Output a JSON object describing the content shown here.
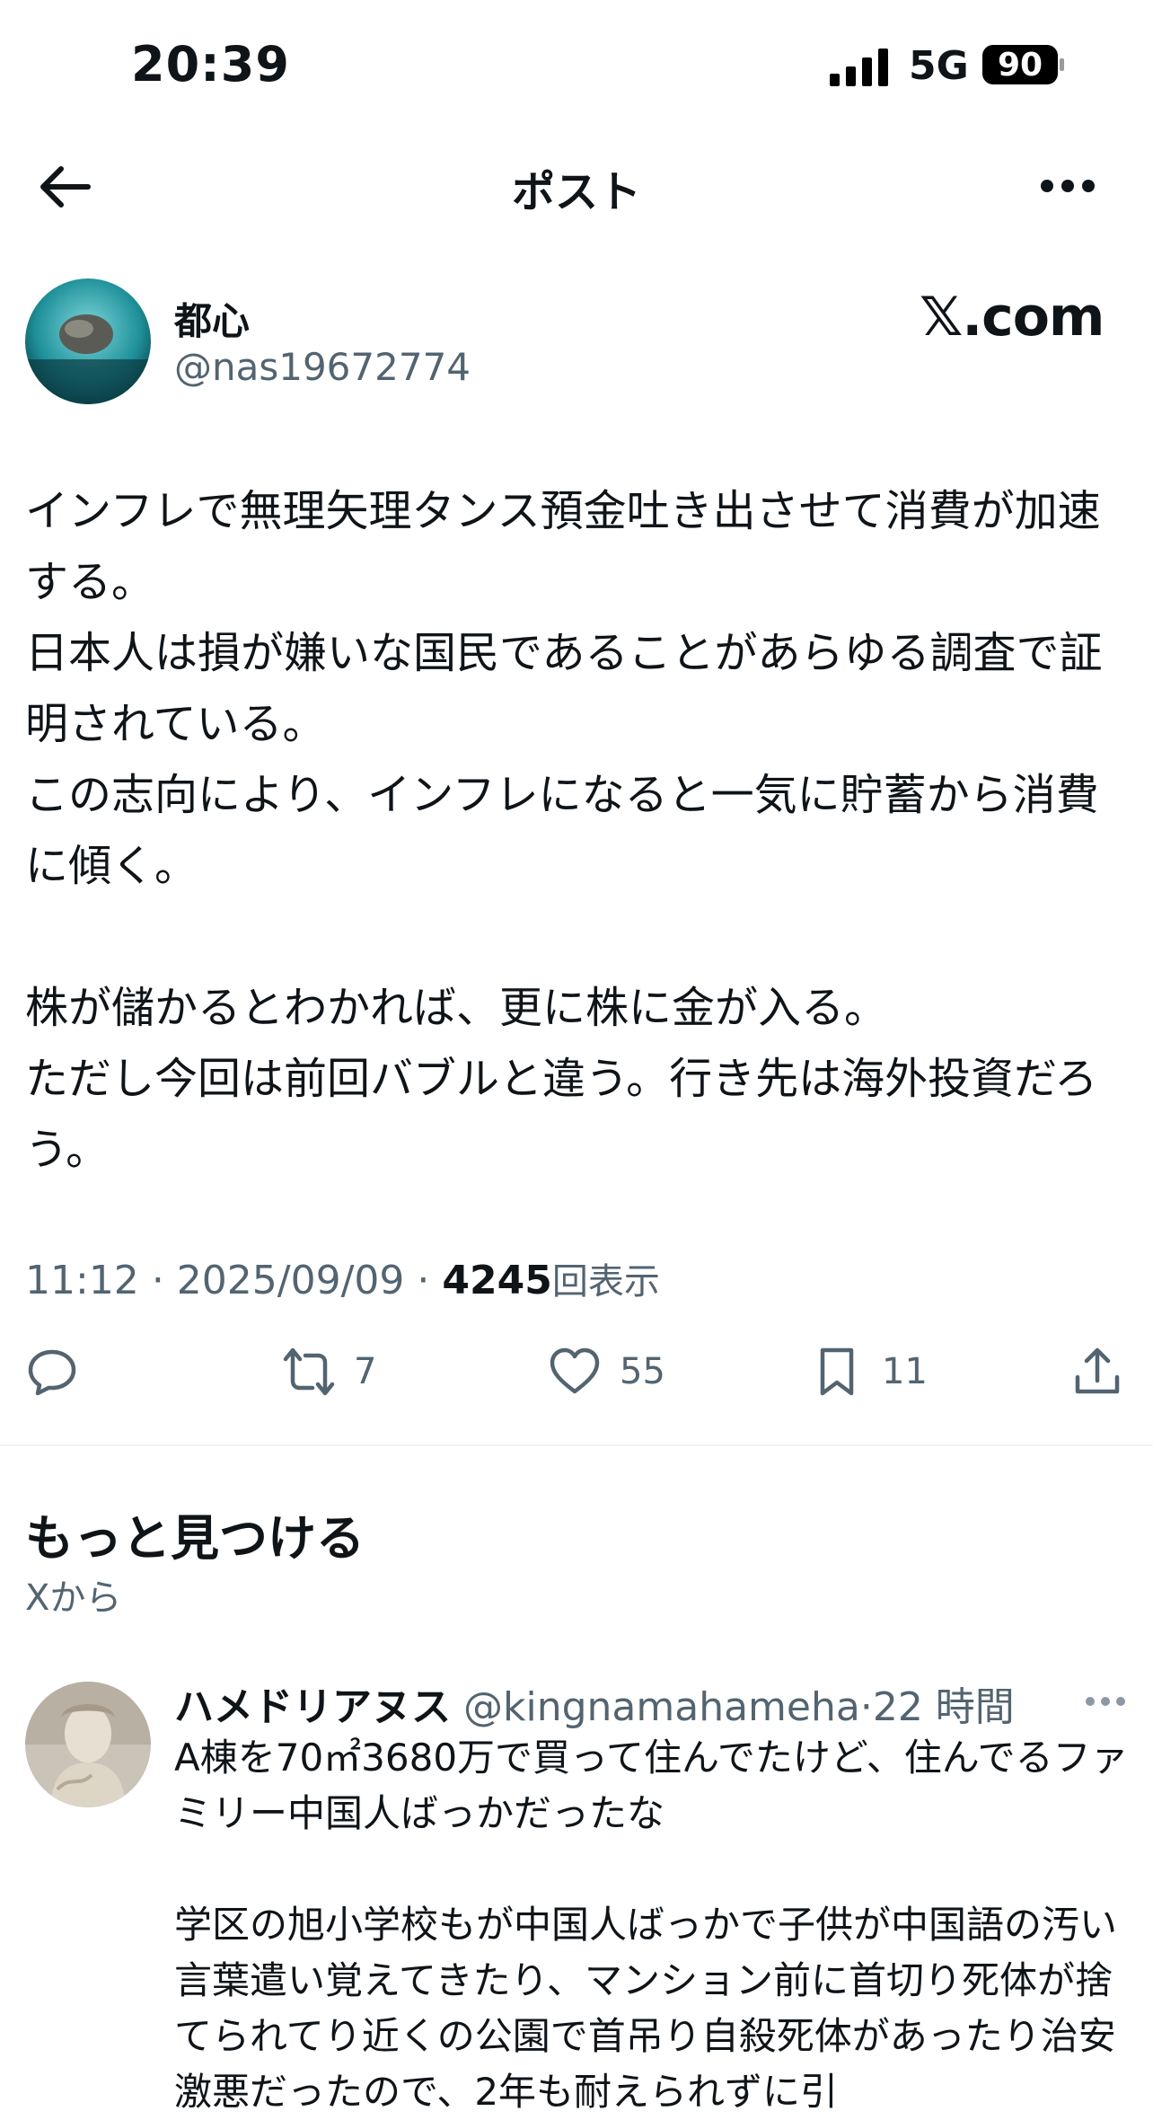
{
  "status_bar": {
    "time": "20:39",
    "network": "5G",
    "battery": "90"
  },
  "nav": {
    "title": "ポスト",
    "back_icon": "arrow-left-icon",
    "more_icon": "ellipsis-icon"
  },
  "author": {
    "name": "都心",
    "handle": "@nas19672774",
    "source_badge": "𝕏.com"
  },
  "post": {
    "text": "インフレで無理矢理タンス預金吐き出させて消費が加速する。\n日本人は損が嫌いな国民であることがあらゆる調査で証明されている。\nこの志向により、インフレになると一気に貯蓄から消費に傾く。\n\n株が儲かるとわかれば、更に株に金が入る。\nただし今回は前回バブルと違う。行き先は海外投資だろう。",
    "time": "11:12",
    "date": "2025/09/09",
    "views": "4245",
    "views_label": "回表示"
  },
  "actions": {
    "reply": {
      "icon": "reply-icon",
      "count": ""
    },
    "repost": {
      "icon": "repost-icon",
      "count": "7"
    },
    "like": {
      "icon": "heart-icon",
      "count": "55"
    },
    "bookmark": {
      "icon": "bookmark-icon",
      "count": "11"
    },
    "share": {
      "icon": "share-icon"
    }
  },
  "discover": {
    "title": "もっと見つける",
    "subtitle": "Xから"
  },
  "reply_post": {
    "name": "ハメドリアヌス",
    "handle": "@kingnamahameha",
    "separator": "·",
    "time": "22 時間",
    "text": "A棟を70㎡3680万で買って住んでたけど、住んでるファミリー中国人ばっかだったな\n\n学区の旭小学校もが中国人ばっかで子供が中国語の汚い言葉遣い覚えてきたり、マンション前に首切り死体が捨てられてり近くの公園で首吊り自殺死体があったり治安激悪だったので、2年も耐えられずに引"
  },
  "colors": {
    "text": "#0f1419",
    "secondary": "#536471",
    "divider": "#eff3f4"
  }
}
